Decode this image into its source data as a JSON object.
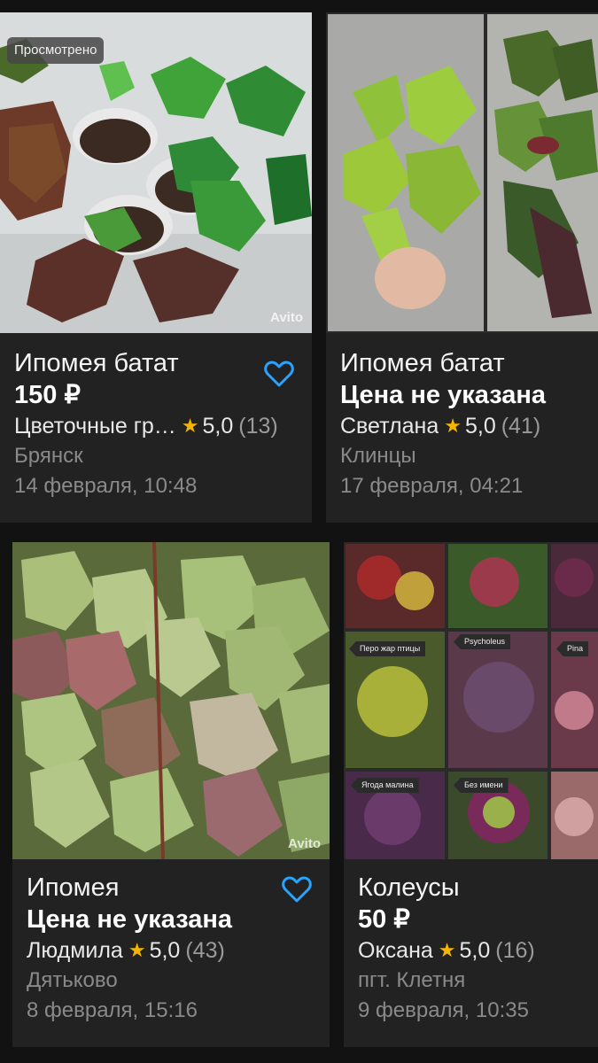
{
  "cards": [
    {
      "title": "Ипомея батат",
      "price": "150 ₽",
      "seller": "Цветочные гр…",
      "rating": "5,0",
      "reviews": "(13)",
      "city": "Брянск",
      "date": "14 февраля, 10:48",
      "badge": "Просмотрено",
      "watermark": "Avito",
      "favorite_icon": "heart-outline-icon",
      "accent": "#2aa3ff"
    },
    {
      "title": "Ипомея батат",
      "price": "Цена не указана",
      "seller": "Светлана",
      "rating": "5,0",
      "reviews": "(41)",
      "city": "Клинцы",
      "date": "17 февраля, 04:21"
    },
    {
      "title": "Ипомея",
      "price": "Цена не указана",
      "seller": "Людмила",
      "rating": "5,0",
      "reviews": "(43)",
      "city": "Дятьково",
      "date": "8 февраля, 15:16",
      "watermark": "Avito",
      "favorite_icon": "heart-outline-icon"
    },
    {
      "title": "Колеусы",
      "price": "50 ₽",
      "seller": "Оксана",
      "rating": "5,0",
      "reviews": "(16)",
      "city": "пгт. Клетня",
      "date": "9 февраля, 10:35",
      "collage_tags": [
        "Перо жар птицы",
        "Psycholeus",
        "Pina",
        "Ягода малина",
        "Без имени"
      ]
    }
  ],
  "colors": {
    "background": "#121212",
    "card": "#222222",
    "star": "#f4b400",
    "muted_text": "#8a8a8a",
    "heart": "#2aa3ff"
  }
}
